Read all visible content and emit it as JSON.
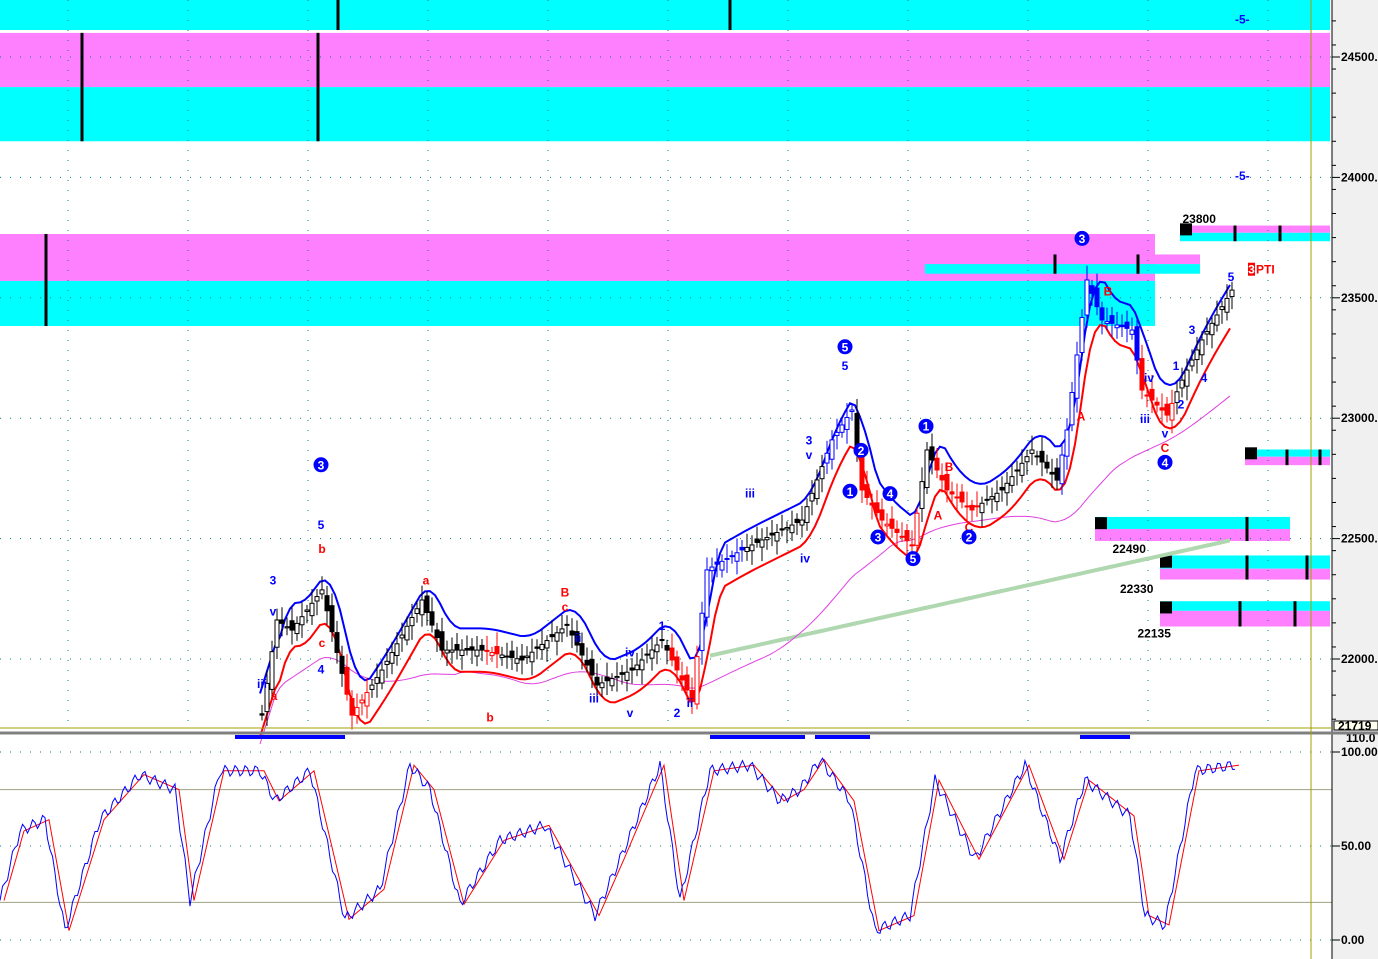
{
  "chart_data": {
    "type": "candlestick",
    "title": "",
    "price_axis": {
      "ticks": [
        24500,
        24000,
        23500,
        23000,
        22500,
        22000
      ],
      "tick_labels": [
        "24500.",
        "24000.",
        "23500.",
        "23000.",
        "22500.",
        "22000."
      ],
      "current_label": "21719",
      "range": [
        21719,
        24737
      ]
    },
    "oscillator_axis": {
      "ticks": [
        100,
        50,
        0
      ],
      "tick_labels": [
        "100.00",
        "50.00",
        "0.00"
      ],
      "top_label": "110.0",
      "levels": [
        80,
        20
      ],
      "range": [
        -2,
        110
      ]
    },
    "price_path": [
      [
        52,
        21767
      ],
      [
        55,
        22162
      ],
      [
        58,
        22120
      ],
      [
        64,
        22287
      ],
      [
        70,
        21767
      ],
      [
        76,
        21954
      ],
      [
        84,
        22245
      ],
      [
        88,
        22037
      ],
      [
        96,
        22037
      ],
      [
        104,
        21996
      ],
      [
        113,
        22141
      ],
      [
        119,
        21892
      ],
      [
        126,
        21954
      ],
      [
        132,
        22079
      ],
      [
        138,
        21830
      ],
      [
        141,
        22370
      ],
      [
        148,
        22453
      ],
      [
        160,
        22577
      ],
      [
        166,
        22910
      ],
      [
        170,
        23034
      ],
      [
        172,
        22702
      ],
      [
        176,
        22577
      ],
      [
        182,
        22474
      ],
      [
        185,
        22868
      ],
      [
        189,
        22702
      ],
      [
        194,
        22619
      ],
      [
        200,
        22702
      ],
      [
        206,
        22868
      ],
      [
        211,
        22743
      ],
      [
        213,
        22951
      ],
      [
        217,
        23574
      ],
      [
        220,
        23408
      ],
      [
        226,
        23366
      ],
      [
        228,
        23117
      ],
      [
        233,
        23013
      ],
      [
        236,
        23158
      ],
      [
        240,
        23325
      ],
      [
        246,
        23532
      ]
    ],
    "stochastic_path": [
      [
        0,
        21
      ],
      [
        4,
        58
      ],
      [
        9,
        64
      ],
      [
        13,
        5
      ],
      [
        20,
        64
      ],
      [
        28,
        88
      ],
      [
        35,
        80
      ],
      [
        38,
        21
      ],
      [
        44,
        90
      ],
      [
        52,
        90
      ],
      [
        55,
        74
      ],
      [
        62,
        90
      ],
      [
        69,
        11
      ],
      [
        76,
        27
      ],
      [
        82,
        93
      ],
      [
        86,
        80
      ],
      [
        92,
        19
      ],
      [
        100,
        53
      ],
      [
        109,
        61
      ],
      [
        119,
        13
      ],
      [
        124,
        43
      ],
      [
        132,
        93
      ],
      [
        136,
        21
      ],
      [
        142,
        90
      ],
      [
        150,
        93
      ],
      [
        156,
        74
      ],
      [
        160,
        80
      ],
      [
        164,
        96
      ],
      [
        170,
        74
      ],
      [
        175,
        5
      ],
      [
        182,
        13
      ],
      [
        187,
        85
      ],
      [
        195,
        43
      ],
      [
        205,
        93
      ],
      [
        212,
        43
      ],
      [
        217,
        85
      ],
      [
        226,
        66
      ],
      [
        229,
        13
      ],
      [
        233,
        8
      ],
      [
        239,
        90
      ],
      [
        247,
        93
      ]
    ],
    "zones": [
      {
        "from": 0,
        "to": 266,
        "low": 24612,
        "high": 24737,
        "color": "#00ffff"
      },
      {
        "from": 0,
        "to": 266,
        "low": 24375,
        "high": 24600,
        "color": "#ff80ff"
      },
      {
        "from": 0,
        "to": 266,
        "low": 24150,
        "high": 24375,
        "color": "#00ffff"
      },
      {
        "from": 0,
        "to": 231,
        "low": 23570,
        "high": 23765,
        "color": "#ff80ff"
      },
      {
        "from": 0,
        "to": 231,
        "low": 23383,
        "high": 23570,
        "color": "#00ffff"
      },
      {
        "from": 185,
        "to": 240,
        "low": 23640,
        "high": 23680,
        "color": "#ff80ff"
      },
      {
        "from": 185,
        "to": 240,
        "low": 23600,
        "high": 23640,
        "color": "#00ffff"
      },
      {
        "from": 236,
        "to": 266,
        "low": 23770,
        "high": 23800,
        "color": "#ff80ff"
      },
      {
        "from": 236,
        "to": 266,
        "low": 23735,
        "high": 23770,
        "color": "#00ffff"
      },
      {
        "from": 249,
        "to": 266,
        "low": 22840,
        "high": 22870,
        "color": "#00ffff"
      },
      {
        "from": 249,
        "to": 266,
        "low": 22805,
        "high": 22840,
        "color": "#ff80ff"
      },
      {
        "from": 219,
        "to": 258,
        "low": 22540,
        "high": 22590,
        "color": "#00ffff"
      },
      {
        "from": 219,
        "to": 258,
        "low": 22490,
        "high": 22540,
        "color": "#ff80ff"
      },
      {
        "from": 232,
        "to": 266,
        "low": 22375,
        "high": 22430,
        "color": "#00ffff"
      },
      {
        "from": 232,
        "to": 266,
        "low": 22330,
        "high": 22375,
        "color": "#ff80ff"
      },
      {
        "from": 232,
        "to": 266,
        "low": 22200,
        "high": 22240,
        "color": "#00ffff"
      },
      {
        "from": 232,
        "to": 266,
        "low": 22135,
        "high": 22200,
        "color": "#ff80ff"
      }
    ],
    "zone_markers": [
      [
        67.6,
        24612,
        24737
      ],
      [
        146,
        24612,
        24737
      ],
      [
        16.4,
        24150,
        24600
      ],
      [
        63.6,
        24150,
        24600
      ],
      [
        9.2,
        23383,
        23765
      ],
      [
        211,
        23600,
        23680
      ],
      [
        227.6,
        23600,
        23680
      ],
      [
        247,
        23735,
        23800
      ],
      [
        256,
        23735,
        23800
      ],
      [
        257.4,
        22805,
        22870
      ],
      [
        264,
        22805,
        22870
      ],
      [
        249.4,
        22490,
        22590
      ],
      [
        249.4,
        22330,
        22430
      ],
      [
        261.4,
        22330,
        22430
      ],
      [
        248,
        22135,
        22240
      ],
      [
        259,
        22135,
        22240
      ]
    ],
    "level_labels": [
      {
        "text": "23800",
        "t": 236.5,
        "price": 23810
      },
      {
        "text": "22490",
        "t": 222.5,
        "price": 22440
      },
      {
        "text": "22330",
        "t": 224,
        "price": 22275
      },
      {
        "text": "22135",
        "t": 227.5,
        "price": 22090
      },
      {
        "text": "-5-",
        "t": 247,
        "price": 24640
      },
      {
        "text": "-5-",
        "t": 247,
        "price": 23990
      }
    ],
    "wave_labels": [
      {
        "text": "3",
        "t": 64.2,
        "price": 22790,
        "color": "#0000ff",
        "circled": true
      },
      {
        "text": "5",
        "t": 64.2,
        "price": 22540,
        "color": "#0000ff"
      },
      {
        "text": "b",
        "t": 64.4,
        "price": 22440,
        "color": "#ff0000"
      },
      {
        "text": "3",
        "t": 54.6,
        "price": 22310,
        "color": "#0000ff"
      },
      {
        "text": "v",
        "t": 54.6,
        "price": 22180,
        "color": "#0000ff"
      },
      {
        "text": "iii",
        "t": 52.4,
        "price": 21880,
        "color": "#0000ff"
      },
      {
        "text": "a",
        "t": 54.8,
        "price": 21830,
        "color": "#ff0000"
      },
      {
        "text": "c",
        "t": 64.4,
        "price": 22050,
        "color": "#ff0000"
      },
      {
        "text": "4",
        "t": 64.2,
        "price": 21940,
        "color": "#0000ff"
      },
      {
        "text": "a",
        "t": 85.2,
        "price": 22310,
        "color": "#ff0000"
      },
      {
        "text": "b",
        "t": 98,
        "price": 21740,
        "color": "#ff0000"
      },
      {
        "text": "B",
        "t": 113,
        "price": 22260,
        "color": "#ff0000"
      },
      {
        "text": "c",
        "t": 113,
        "price": 22200,
        "color": "#ff0000"
      },
      {
        "text": "ii",
        "t": 115.6,
        "price": 22070,
        "color": "#0000ff"
      },
      {
        "text": "iii",
        "t": 118.8,
        "price": 21820,
        "color": "#0000ff"
      },
      {
        "text": "iv",
        "t": 126,
        "price": 22010,
        "color": "#0000ff"
      },
      {
        "text": "v",
        "t": 126,
        "price": 21760,
        "color": "#0000ff"
      },
      {
        "text": "1",
        "t": 132.4,
        "price": 22120,
        "color": "#0000ff"
      },
      {
        "text": "2",
        "t": 135.4,
        "price": 21760,
        "color": "#0000ff"
      },
      {
        "text": "ii",
        "t": 138,
        "price": 21800,
        "color": "#0000ff"
      },
      {
        "text": "iii",
        "t": 150,
        "price": 22670,
        "color": "#0000ff"
      },
      {
        "text": "iv",
        "t": 161,
        "price": 22400,
        "color": "#0000ff"
      },
      {
        "text": "3",
        "t": 161.8,
        "price": 22890,
        "color": "#0000ff"
      },
      {
        "text": "v",
        "t": 161.8,
        "price": 22830,
        "color": "#0000ff"
      },
      {
        "text": "5",
        "t": 169,
        "price": 23280,
        "color": "#0000ff",
        "circled": true
      },
      {
        "text": "5",
        "t": 169,
        "price": 23200,
        "color": "#0000ff"
      },
      {
        "text": "1",
        "t": 170,
        "price": 22680,
        "color": "#0000ff",
        "circled": true
      },
      {
        "text": "2",
        "t": 172.2,
        "price": 22850,
        "color": "#0000ff",
        "circled": true
      },
      {
        "text": "4",
        "t": 178,
        "price": 22670,
        "color": "#0000ff",
        "circled": true
      },
      {
        "text": "3",
        "t": 175.6,
        "price": 22490,
        "color": "#0000ff",
        "circled": true
      },
      {
        "text": "5",
        "t": 182.6,
        "price": 22400,
        "color": "#0000ff",
        "circled": true
      },
      {
        "text": "1",
        "t": 185.2,
        "price": 22950,
        "color": "#0000ff",
        "circled": true
      },
      {
        "text": "B",
        "t": 189.8,
        "price": 22780,
        "color": "#ff0000"
      },
      {
        "text": "A",
        "t": 187.6,
        "price": 22580,
        "color": "#ff0000"
      },
      {
        "text": "C",
        "t": 193.8,
        "price": 22530,
        "color": "#ff0000"
      },
      {
        "text": "2",
        "t": 193.8,
        "price": 22490,
        "color": "#0000ff",
        "circled": true
      },
      {
        "text": "3",
        "t": 216.4,
        "price": 23730,
        "color": "#0000ff",
        "circled": true
      },
      {
        "text": "B",
        "t": 221.6,
        "price": 23510,
        "color": "#ff0000"
      },
      {
        "text": "A",
        "t": 216.2,
        "price": 22990,
        "color": "#ff0000"
      },
      {
        "text": "iv",
        "t": 229.8,
        "price": 23150,
        "color": "#0000ff"
      },
      {
        "text": "iii",
        "t": 229,
        "price": 22980,
        "color": "#0000ff"
      },
      {
        "text": "v",
        "t": 233,
        "price": 22920,
        "color": "#0000ff"
      },
      {
        "text": "C",
        "t": 233,
        "price": 22860,
        "color": "#ff0000"
      },
      {
        "text": "4",
        "t": 233,
        "price": 22800,
        "color": "#0000ff",
        "circled": true
      },
      {
        "text": "1",
        "t": 235.2,
        "price": 23200,
        "color": "#0000ff"
      },
      {
        "text": "2",
        "t": 236.2,
        "price": 23040,
        "color": "#0000ff"
      },
      {
        "text": "3",
        "t": 238.4,
        "price": 23350,
        "color": "#0000ff"
      },
      {
        "text": "4",
        "t": 240.8,
        "price": 23150,
        "color": "#0000ff"
      },
      {
        "text": "5",
        "t": 246.2,
        "price": 23570,
        "color": "#0000ff"
      },
      {
        "text": "PTI",
        "t": 251.2,
        "price": 23600,
        "color": "#ff0000",
        "boxed_prefix": "3"
      }
    ],
    "oscillator_highlights": [
      [
        47,
        69
      ],
      [
        142,
        161
      ],
      [
        163,
        174
      ],
      [
        216,
        226
      ]
    ],
    "colors": {
      "upper_band": "#0000ff",
      "lower_band": "#ff0000",
      "ma_short": "#e040e0",
      "ma_long": "#b0d8b0",
      "stoch_k": "#0000ff",
      "stoch_d": "#ff0000",
      "cursor": "#a0a000"
    }
  }
}
